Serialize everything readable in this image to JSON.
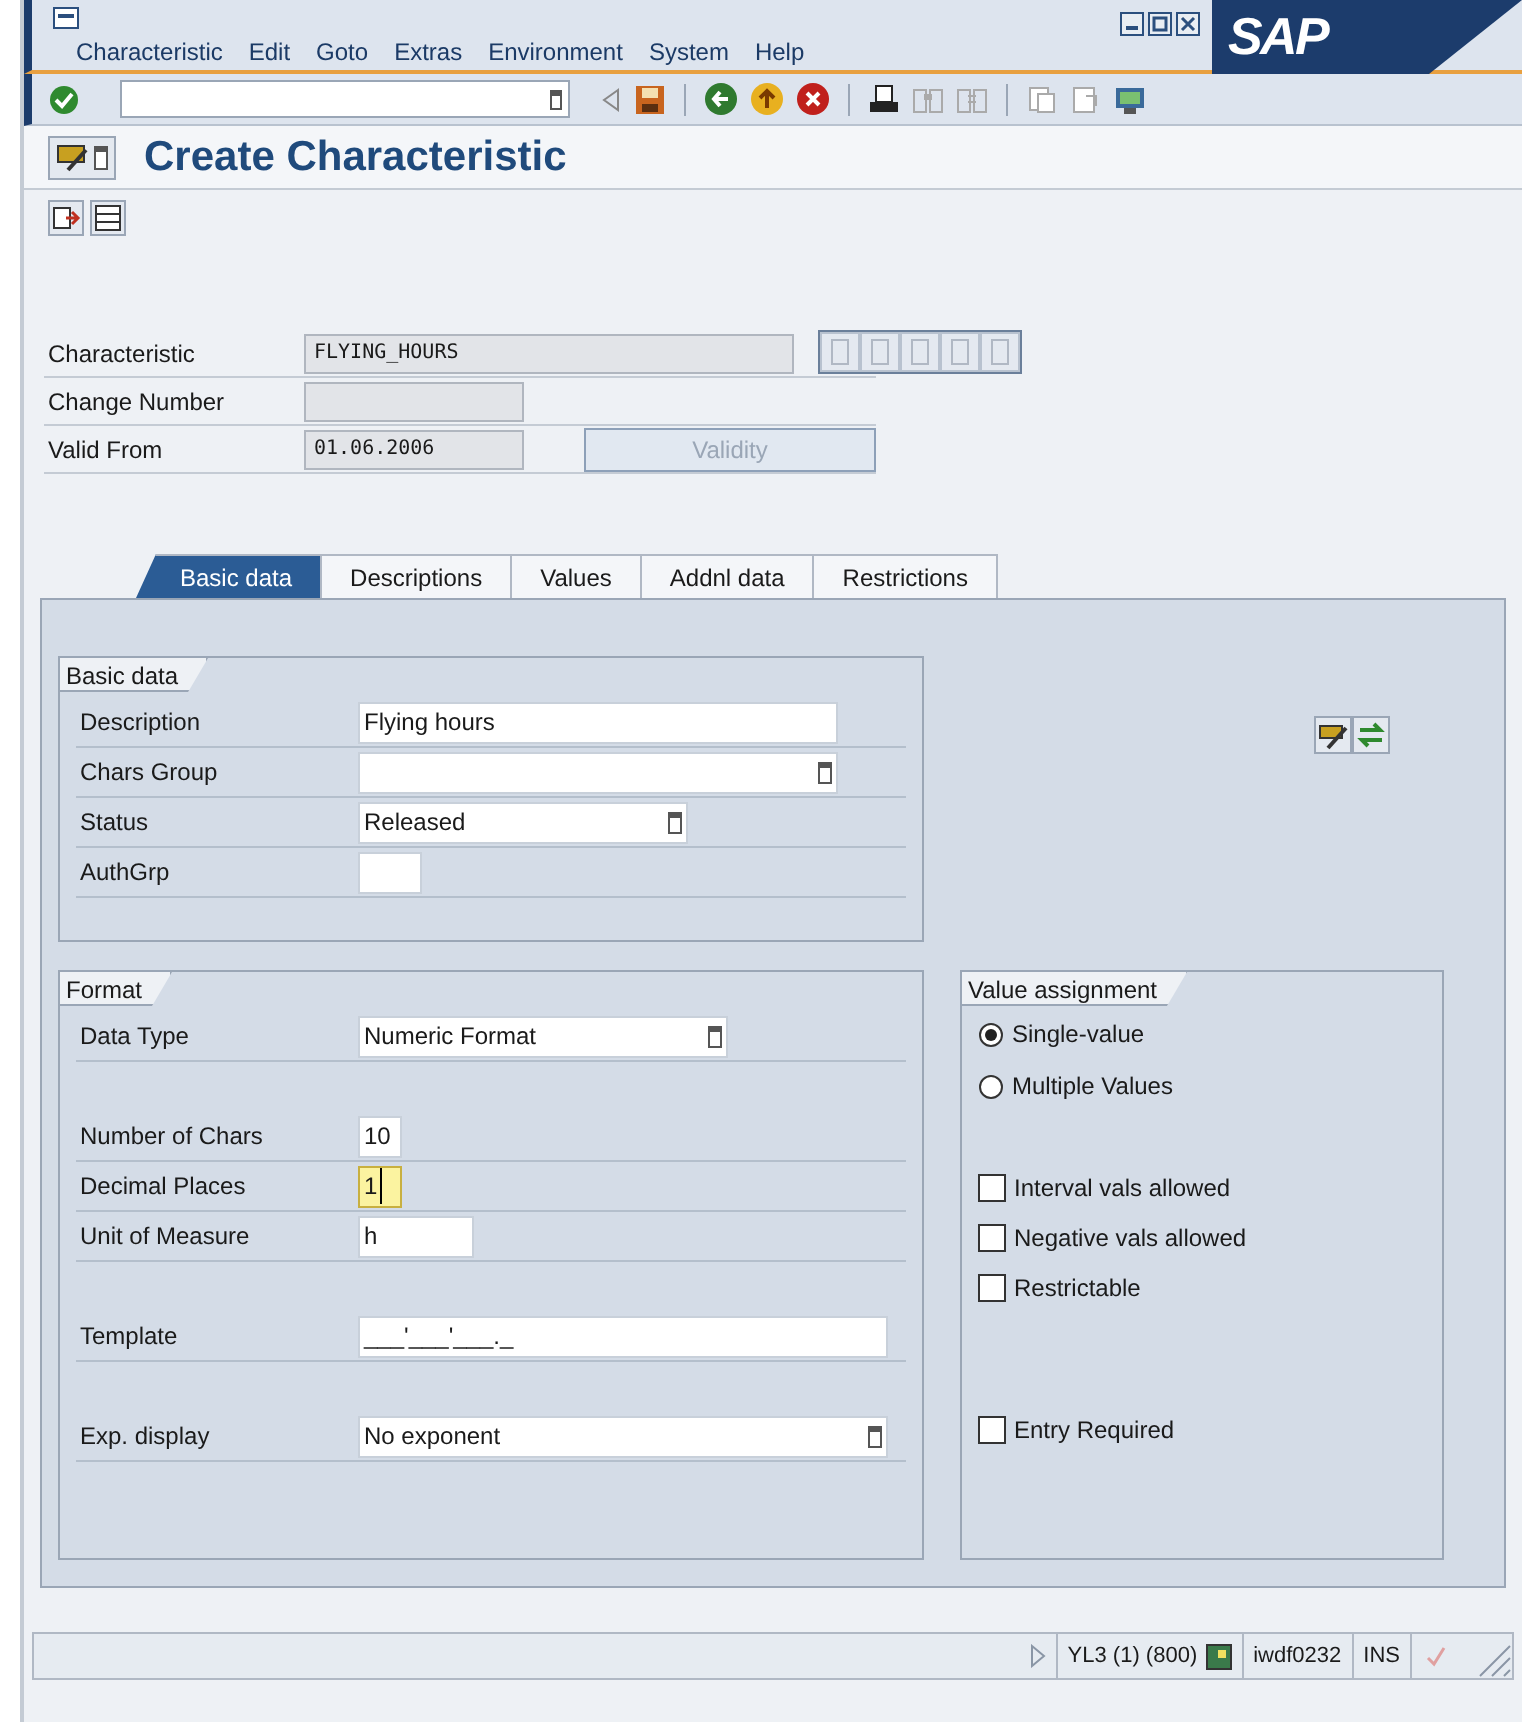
{
  "menu_bar": {
    "items": [
      {
        "label": "Characteristic"
      },
      {
        "label": "Edit"
      },
      {
        "label": "Goto"
      },
      {
        "label": "Extras"
      },
      {
        "label": "Environment"
      },
      {
        "label": "System"
      },
      {
        "label": "Help"
      }
    ]
  },
  "logo": {
    "text": "SAP"
  },
  "title": "Create Characteristic",
  "header": {
    "fields": [
      {
        "label": "Characteristic",
        "value": "FLYING_HOURS"
      },
      {
        "label": "Change Number"
      },
      {
        "label": "Valid From",
        "value": "01.06.2006"
      }
    ],
    "validity_button": {
      "label": "Validity",
      "disabled": true
    }
  },
  "tabs": [
    {
      "label": "Basic data",
      "selected": true
    },
    {
      "label": "Descriptions",
      "selected": false
    },
    {
      "label": "Values",
      "selected": false
    },
    {
      "label": "Addnl data",
      "selected": false
    },
    {
      "label": "Restrictions",
      "selected": false
    }
  ],
  "basic_data": {
    "title": "Basic data",
    "fields": [
      {
        "label": "Description",
        "value": "Flying hours",
        "kind": "input"
      },
      {
        "label": "Chars Group",
        "kind": "dropdown"
      },
      {
        "label": "Status",
        "value": "Released",
        "kind": "dropdown"
      },
      {
        "label": "AuthGrp",
        "kind": "input"
      }
    ]
  },
  "format": {
    "title": "Format",
    "fields": [
      {
        "label": "Data Type",
        "value": "Numeric Format",
        "kind": "dropdown"
      },
      {
        "label": "Number of Chars",
        "value": "10",
        "kind": "input"
      },
      {
        "label": "Decimal Places",
        "value": "1",
        "kind": "input",
        "focused": true
      },
      {
        "label": "Unit of Measure",
        "value": "h",
        "kind": "input"
      },
      {
        "label": "Template",
        "value": "___'___'___._",
        "kind": "input"
      },
      {
        "label": "Exp. display",
        "value": "No exponent",
        "kind": "dropdown"
      }
    ]
  },
  "value_assignment": {
    "title": "Value assignment",
    "options": [
      {
        "label": "Single-value",
        "kind": "radio",
        "selected": true
      },
      {
        "label": "Multiple Values",
        "kind": "radio",
        "selected": false
      },
      {
        "label": "Interval vals allowed",
        "kind": "checkbox",
        "checked": false
      },
      {
        "label": "Negative vals allowed",
        "kind": "checkbox",
        "checked": false
      },
      {
        "label": "Restrictable",
        "kind": "checkbox",
        "checked": false
      },
      {
        "label": "Entry Required",
        "kind": "checkbox",
        "checked": false
      }
    ]
  },
  "status_bar": {
    "segments": [
      "YL3 (1) (800)",
      "iwdf0232",
      "INS"
    ]
  }
}
